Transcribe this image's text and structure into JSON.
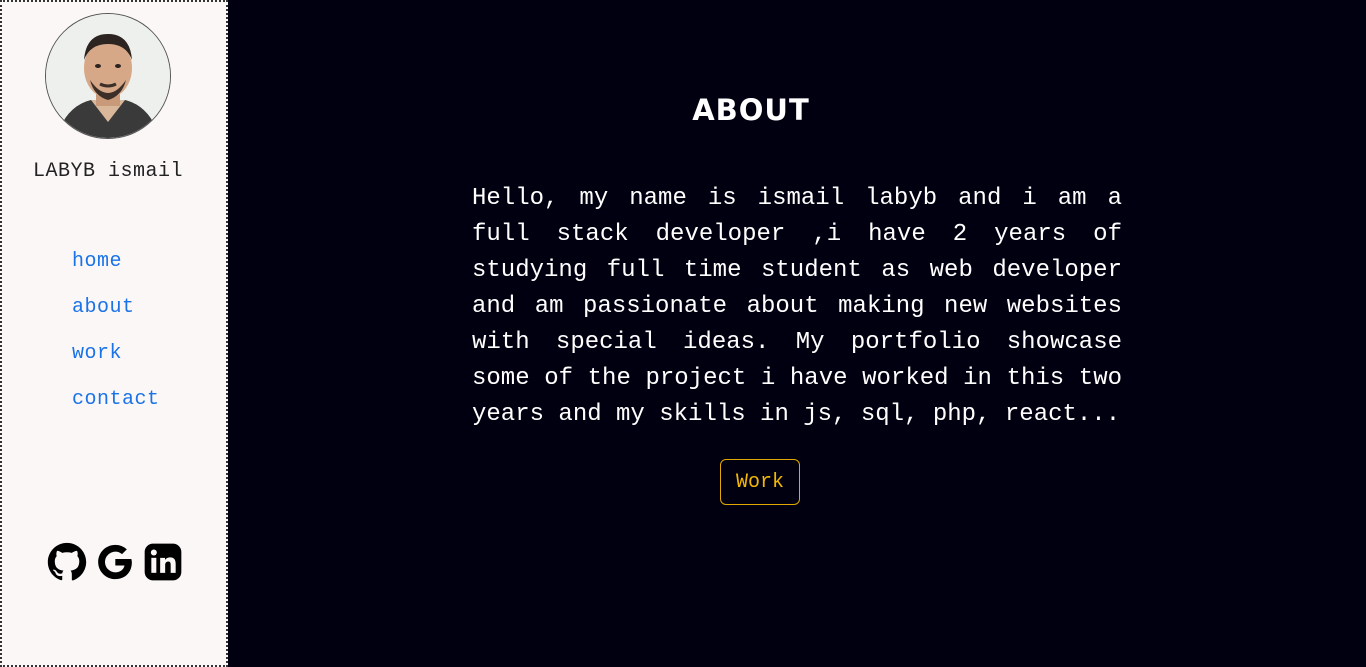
{
  "profile": {
    "name": "LABYB ismail"
  },
  "nav": {
    "items": [
      {
        "label": "home"
      },
      {
        "label": "about"
      },
      {
        "label": "work"
      },
      {
        "label": "contact"
      }
    ]
  },
  "social": {
    "icons": [
      "github-icon",
      "google-icon",
      "linkedin-icon"
    ]
  },
  "about": {
    "title": "ABOUT",
    "text": "Hello, my name is ismail labyb and i am a full stack developer ,i have 2 years of studying full time student as web developer and am passionate about making new websites with special ideas. My portfolio showcase some of the project i have worked in this two years and my skills in js, sql, php, react...",
    "button_label": "Work"
  },
  "colors": {
    "background": "#000010",
    "sidebar": "#fbf7f6",
    "link": "#1a73e8",
    "accent": "#f2b705",
    "text": "#ffffff"
  }
}
